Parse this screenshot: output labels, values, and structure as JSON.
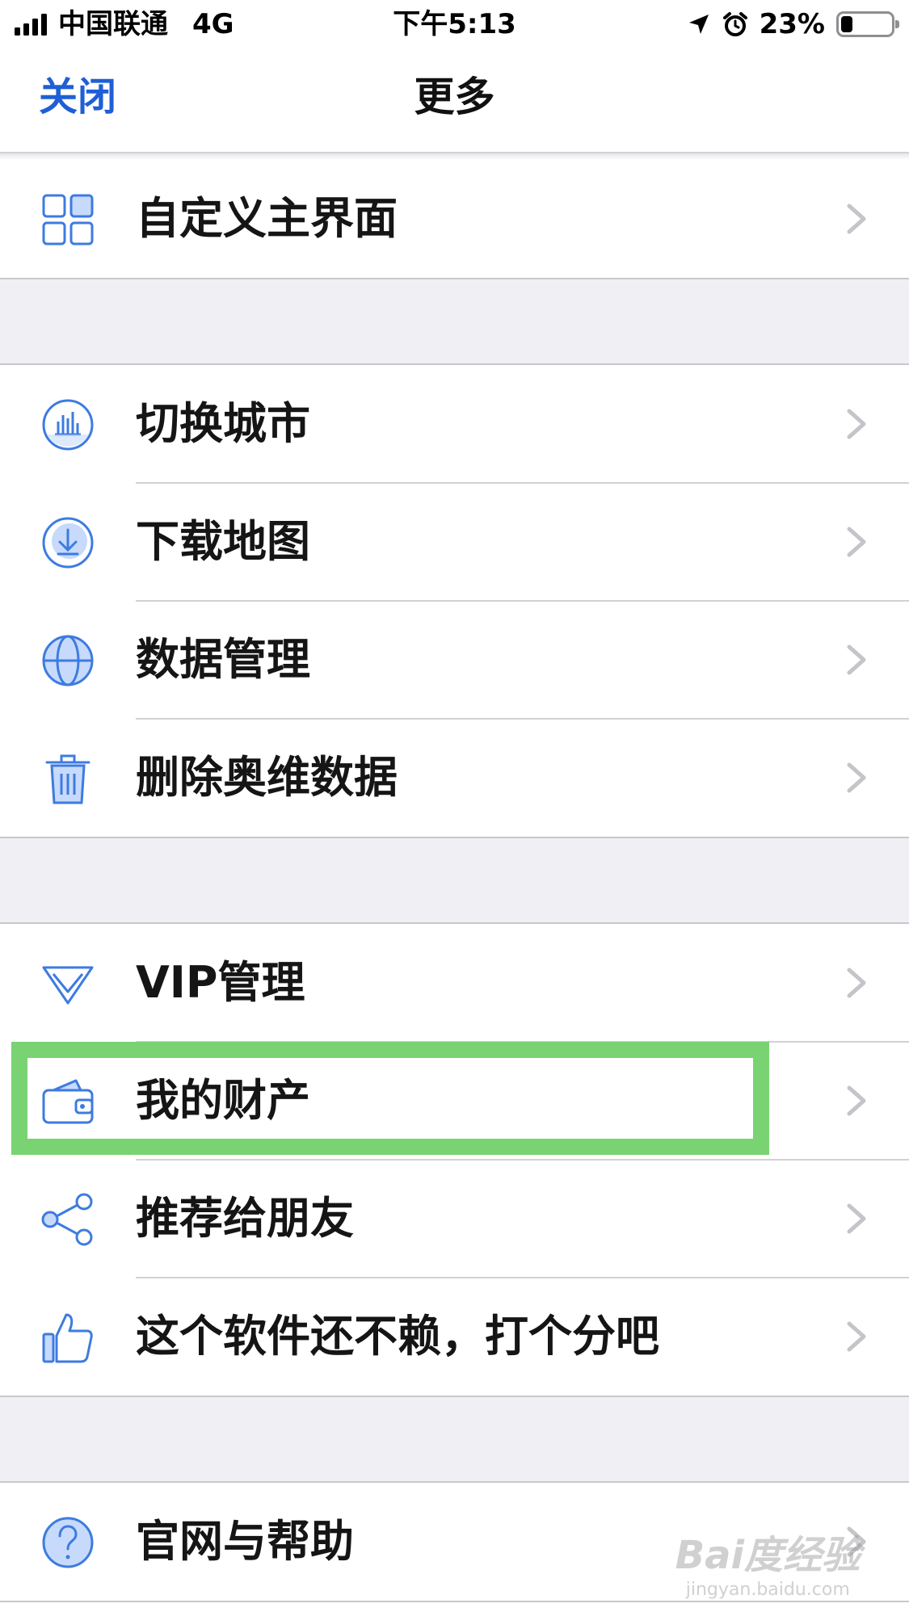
{
  "status_bar": {
    "carrier": "中国联通",
    "network": "4G",
    "time": "下午5:13",
    "battery": "23%",
    "battery_level": 0.23
  },
  "nav": {
    "close_label": "关闭",
    "title": "更多"
  },
  "groups": [
    {
      "items": [
        {
          "label": "自定义主界面",
          "icon": "grid-layout-icon"
        }
      ]
    },
    {
      "items": [
        {
          "label": "切换城市",
          "icon": "city-skyline-icon"
        },
        {
          "label": "下载地图",
          "icon": "download-icon"
        },
        {
          "label": "数据管理",
          "icon": "globe-icon"
        },
        {
          "label": "删除奥维数据",
          "icon": "trash-icon"
        }
      ]
    },
    {
      "items": [
        {
          "label": "VIP管理",
          "icon": "diamond-icon"
        },
        {
          "label": "我的财产",
          "icon": "wallet-icon"
        },
        {
          "label": "推荐给朋友",
          "icon": "share-icon"
        },
        {
          "label": "这个软件还不赖，打个分吧",
          "icon": "thumbs-up-icon"
        }
      ]
    },
    {
      "items": [
        {
          "label": "官网与帮助",
          "icon": "help-icon"
        }
      ]
    }
  ],
  "watermark": {
    "logo": "Bai度经验",
    "url": "jingyan.baidu.com"
  },
  "colors": {
    "accent": "#1f5fd6",
    "icon_blue": "#3d7be0",
    "highlight": "#79d373",
    "separator": "#d1d1d6",
    "group_gap": "#efeff4"
  }
}
